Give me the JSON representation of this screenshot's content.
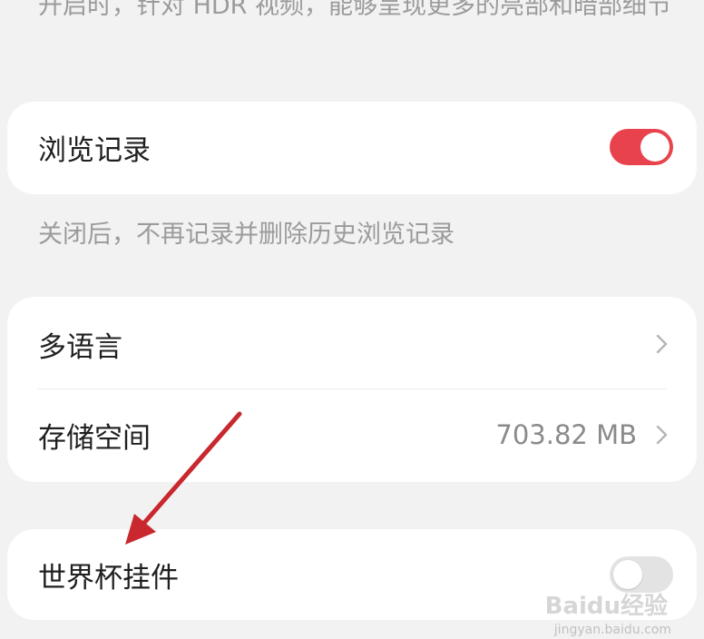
{
  "hdr_section": {
    "description": "开启时，针对 HDR 视频，能够呈现更多的亮部和暗部细节"
  },
  "browsing_history": {
    "label": "浏览记录",
    "toggle_on": true,
    "description": "关闭后，不再记录并删除历史浏览记录"
  },
  "settings_group": {
    "items": [
      {
        "label": "多语言",
        "value": ""
      },
      {
        "label": "存储空间",
        "value": "703.82 MB"
      }
    ]
  },
  "world_cup_widget": {
    "label": "世界杯挂件",
    "toggle_on": false
  },
  "colors": {
    "accent": "#e8434d",
    "annotation_arrow": "#c8282e"
  },
  "watermark": {
    "brand": "Baidu经验",
    "url": "jingyan.baidu.com"
  }
}
